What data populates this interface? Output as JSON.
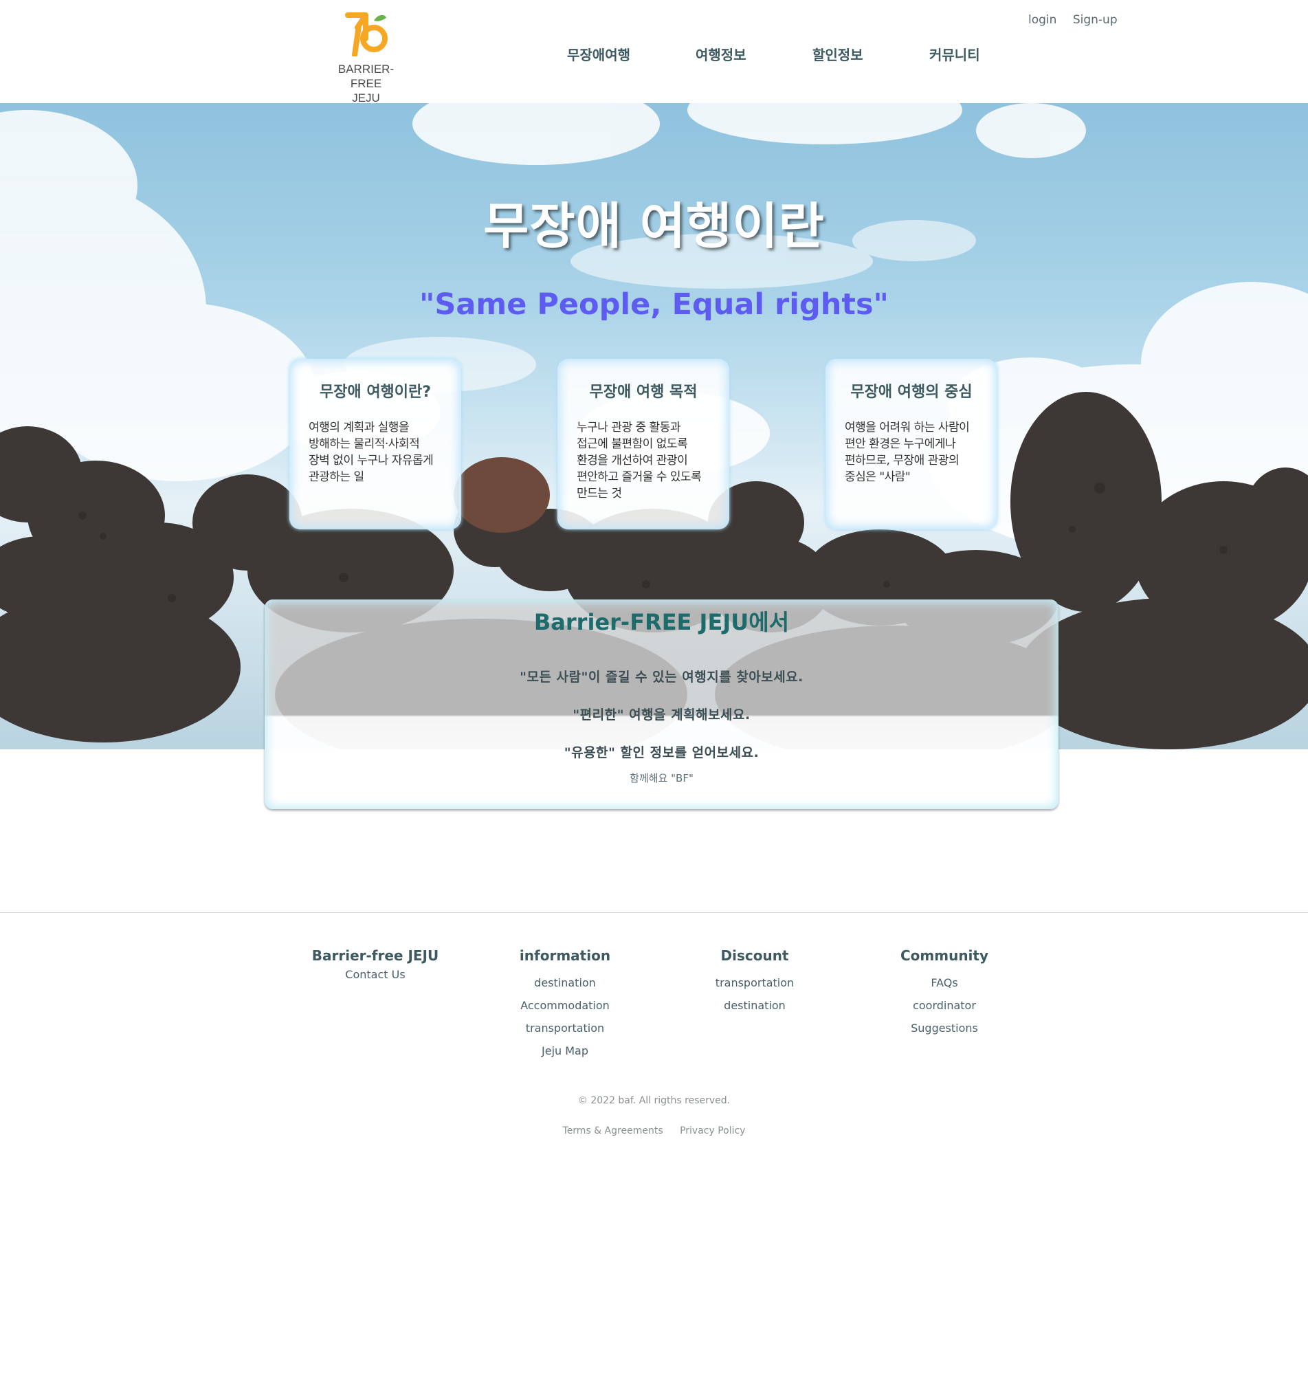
{
  "header": {
    "logo_text_line1": "BARRIER-FREE",
    "logo_text_line2": "JEJU",
    "login": "login",
    "signup": "Sign-up",
    "nav": [
      "무장애여행",
      "여행정보",
      "할인정보",
      "커뮤니티"
    ]
  },
  "hero": {
    "title": "무장애 여행이란",
    "subtitle": "\"Same People, Equal rights\"",
    "cards": [
      {
        "title": "무장애 여행이란?",
        "body": "여행의 계획과 실행을 방해하는 물리적·사회적 장벽 없이 누구나 자유롭게 관광하는 일"
      },
      {
        "title": "무장애 여행 목적",
        "body": "누구나 관광 중 활동과 접근에 불편함이 없도록 환경을 개선하여 관광이 편안하고 즐거울 수 있도록 만드는 것"
      },
      {
        "title": "무장애 여행의 중심",
        "body": "여행을 어려워 하는 사람이 편안 환경은 누구에게나 편하므로, 무장애 관광의 중심은 \"사람\""
      }
    ]
  },
  "panel": {
    "title": "Barrier-FREE JEJU에서",
    "line1": "\"모든 사람\"이 즐길 수 있는 여행지를 찾아보세요.",
    "line2": "\"편리한\" 여행을 계획해보세요.",
    "line3": "\"유용한\" 할인 정보를 얻어보세요.",
    "small": "함께해요 \"BF\""
  },
  "footer": {
    "brand": "Barrier-free JEJU",
    "contact": "Contact Us",
    "information": {
      "title": "information",
      "links": [
        "destination",
        "Accommodation",
        "transportation",
        "Jeju Map"
      ]
    },
    "discount": {
      "title": "Discount",
      "links": [
        "transportation",
        "destination"
      ]
    },
    "community": {
      "title": "Community",
      "links": [
        "FAQs",
        "coordinator",
        "Suggestions"
      ]
    },
    "copyright": "© 2022 baf. All rigths reserved.",
    "terms": "Terms & Agreements",
    "privacy": "Privacy Policy"
  },
  "colors": {
    "logo_orange": "#f5a623",
    "nav_text": "#3e5a60",
    "subtitle_purple": "#5e5cf0",
    "panel_title": "#1e6b6b",
    "card_glow": "#bfe4fa"
  }
}
